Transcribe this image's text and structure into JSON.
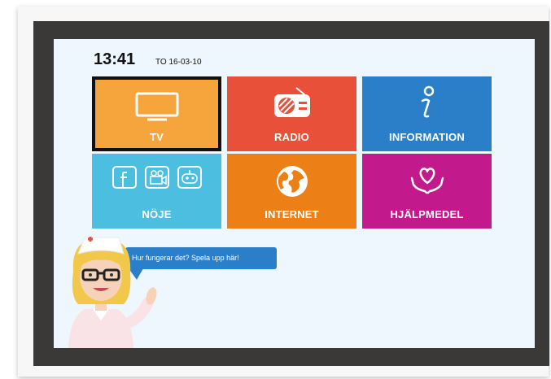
{
  "status": {
    "time": "13:41",
    "date": "TO 16-03-10"
  },
  "tiles": [
    {
      "label": "TV",
      "color": "#f6a53c",
      "icon": "tv-icon",
      "selected": true
    },
    {
      "label": "RADIO",
      "color": "#e8503a",
      "icon": "radio-icon"
    },
    {
      "label": "INFORMATION",
      "color": "#2b7fc8",
      "icon": "info-icon"
    },
    {
      "label": "NÖJE",
      "color": "#4cbfe0",
      "icon": "entertainment-icons"
    },
    {
      "label": "INTERNET",
      "color": "#ec7f15",
      "icon": "globe-icon"
    },
    {
      "label": "HJÄLPMEDEL",
      "color": "#c21a8c",
      "icon": "heart-hands-icon"
    }
  ],
  "help": {
    "bubble_text": "Hur fungerar det? Spela upp här!",
    "bubble_color": "#2b7fc8"
  }
}
